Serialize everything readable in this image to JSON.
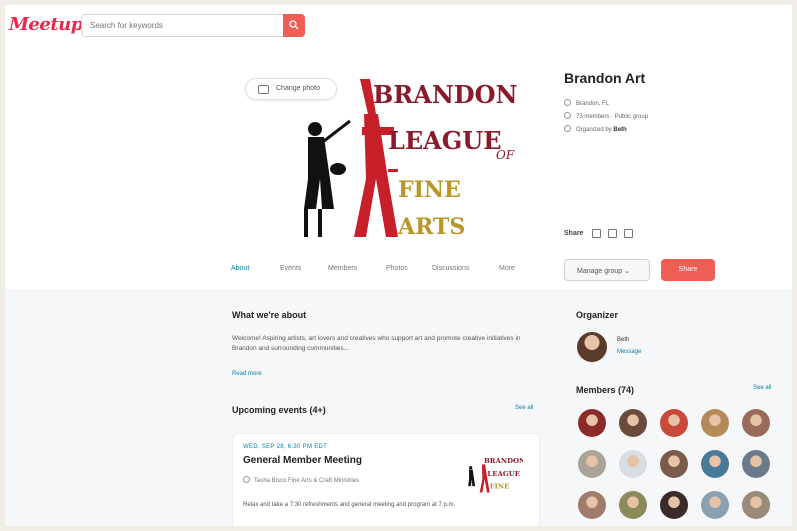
{
  "app": {
    "logo_text": "Meetup",
    "brand_color": "#e8294b"
  },
  "search": {
    "placeholder": "Search for keywords",
    "icon": "search-icon"
  },
  "banner": {
    "change_photo_label": "Change photo",
    "logo_lines": [
      "BRANDON",
      "LEAGUE",
      "OF",
      "FINE",
      "ARTS"
    ]
  },
  "group": {
    "name": "Brandon Art",
    "location": "Brandon, FL",
    "members_text": "73 members · Public group",
    "organized_by_label": "Organized by",
    "organizer_short": "Beth"
  },
  "share": {
    "label": "Share"
  },
  "tabs": [
    "About",
    "Events",
    "Members",
    "Photos",
    "Discussions",
    "More"
  ],
  "actions": {
    "manage_label": "Manage group",
    "share_label": "Share"
  },
  "about": {
    "heading": "What we're about",
    "text": "Welcome! Aspiring artists, art lovers and creatives who support art and promote creative initiatives in Brandon and surrounding communities...",
    "read_more": "Read more"
  },
  "upcoming": {
    "heading": "Upcoming events (4+)",
    "see_all": "See all",
    "event": {
      "date": "WED, SEP 28, 6:30 PM EDT",
      "title": "General Member Meeting",
      "location": "Tasha Bisco Fine Arts & Craft Ministries",
      "description": "Relax and take a 7:30 refreshments and general meeting and program at 7 p.m."
    }
  },
  "organizer": {
    "heading": "Organizer",
    "name": "Beth",
    "role": "Message"
  },
  "members": {
    "heading": "Members (74)",
    "see_all": "See all",
    "avatar_colors": [
      "#8b2a2a",
      "#6a4a3a",
      "#c94a3a",
      "#b58a5a",
      "#9a6a5a",
      "#aaa49a",
      "#d8dde2",
      "#7a5a4a",
      "#4a7a9a",
      "#6a7a8a",
      "#a07a6a",
      "#8a8a5a",
      "#3a2a2a",
      "#8aa0b0",
      "#9a8a7a"
    ]
  },
  "colors": {
    "accent_red": "#ef5e55",
    "link_blue": "#0b7fa8"
  }
}
